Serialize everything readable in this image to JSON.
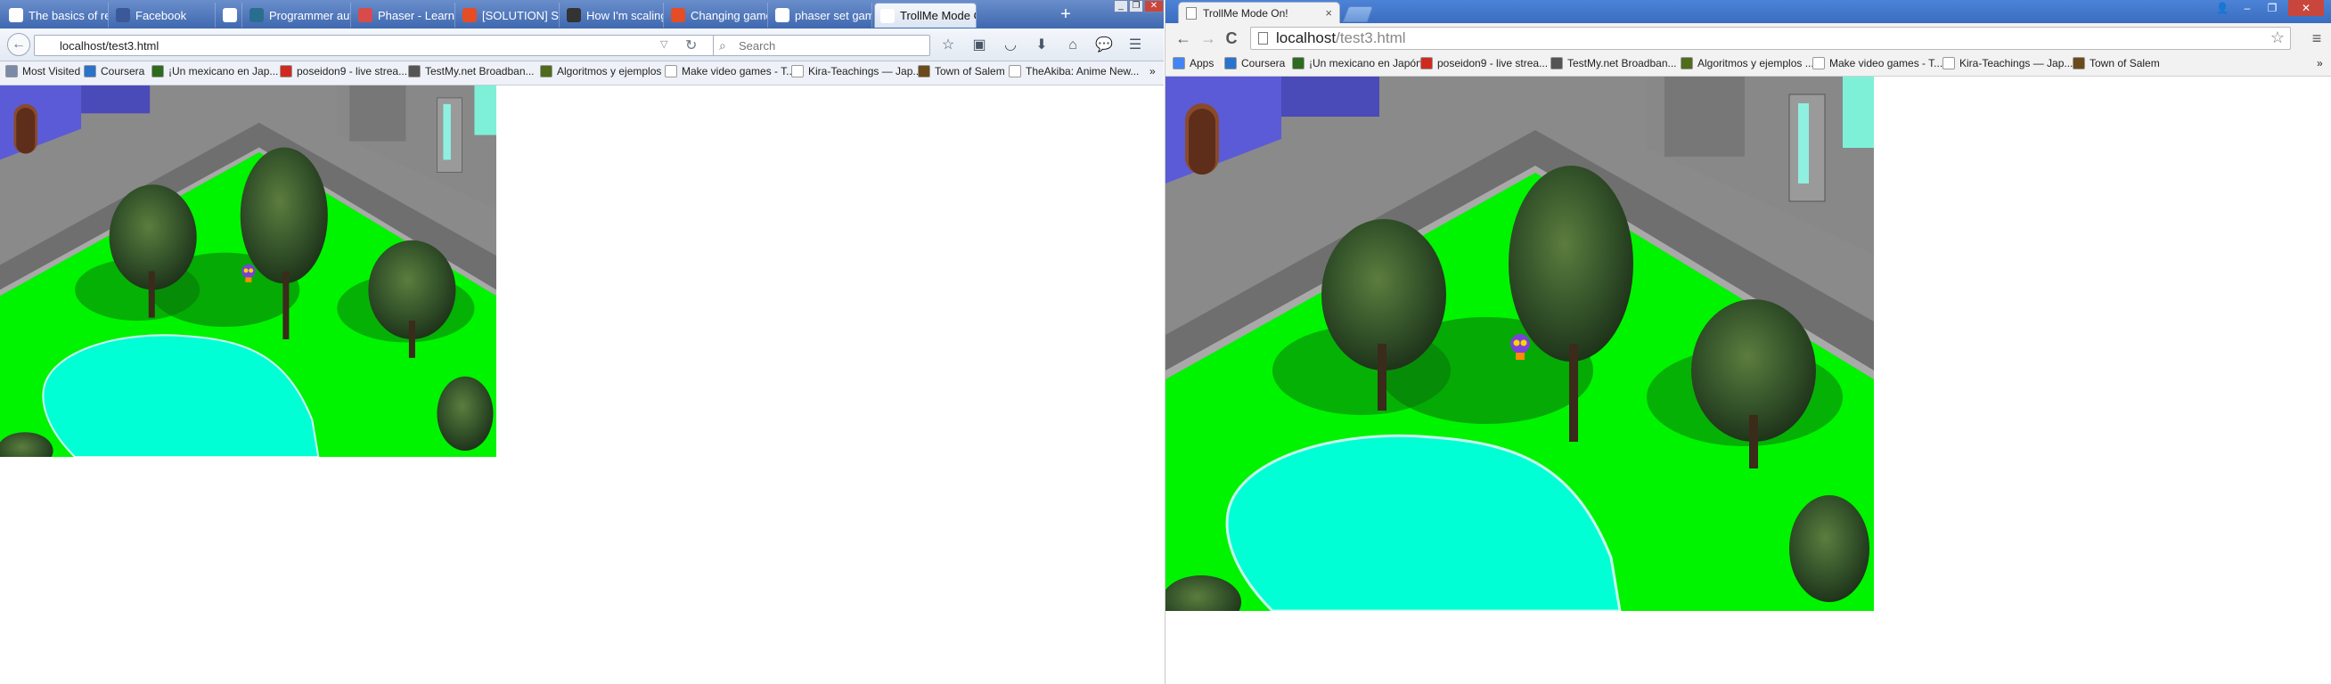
{
  "firefox": {
    "tabs": [
      {
        "label": "The basics of respon...",
        "icon": "page-icon",
        "color": "#ffffff"
      },
      {
        "label": "Facebook",
        "icon": "facebook-icon",
        "color": "#3b5998"
      },
      {
        "label": "",
        "icon": "speaker-icon",
        "color": "#ffffff"
      },
      {
        "label": "Programmer aut...",
        "icon": "bi-icon",
        "color": "#2a6e8f"
      },
      {
        "label": "Phaser - Learn - ...",
        "icon": "phaser-icon",
        "color": "#d84b4b"
      },
      {
        "label": "[SOLUTION] Sca...",
        "icon": "html5-icon",
        "color": "#e44d26"
      },
      {
        "label": "How I'm scaling ...",
        "icon": "github-icon",
        "color": "#333333"
      },
      {
        "label": "Changing game ...",
        "icon": "html5-icon",
        "color": "#e44d26"
      },
      {
        "label": "phaser set game...",
        "icon": "google-icon",
        "color": "#ffffff"
      },
      {
        "label": "TrollMe Mode On!",
        "icon": "page-icon",
        "color": "#ffffff",
        "active": true
      }
    ],
    "newtab": "+",
    "window_buttons": {
      "minimize": "_",
      "restore": "❐",
      "close": "✕"
    },
    "back": "←",
    "url": "localhost/test3.html",
    "url_dropdown": "▽",
    "reload": "↻",
    "search_placeholder": "Search",
    "search_icon": "search-icon",
    "toolbar": [
      {
        "name": "bookmark-star-icon",
        "glyph": "☆"
      },
      {
        "name": "reading-list-icon",
        "glyph": "▣"
      },
      {
        "name": "pocket-icon",
        "glyph": "◡"
      },
      {
        "name": "download-icon",
        "glyph": "⬇"
      },
      {
        "name": "home-icon",
        "glyph": "⌂"
      },
      {
        "name": "chat-icon",
        "glyph": "💬"
      },
      {
        "name": "menu-icon",
        "glyph": "☰"
      }
    ],
    "bookmarks": [
      {
        "label": "Most Visited",
        "color": "#7a8aa8"
      },
      {
        "label": "Coursera",
        "color": "#2a73cc"
      },
      {
        "label": "¡Un mexicano en Jap...",
        "color": "#2d6b1f"
      },
      {
        "label": "poseidon9 - live strea...",
        "color": "#d02a20"
      },
      {
        "label": "TestMy.net Broadban...",
        "color": "#555555"
      },
      {
        "label": "Algoritmos y ejemplos ...",
        "color": "#4f6b1c"
      },
      {
        "label": "Make video games - T...",
        "color": "#ffffff"
      },
      {
        "label": "Kira-Teachings — Jap...",
        "color": "#ffffff"
      },
      {
        "label": "Town of Salem",
        "color": "#6b4a1c"
      },
      {
        "label": "TheAkiba: Anime New...",
        "color": "#ffffff"
      }
    ],
    "overflow": "»"
  },
  "chrome": {
    "tab_title": "TrollMe Mode On!",
    "tab_close": "×",
    "window_buttons": {
      "user": "👤",
      "minimize": "–",
      "restore": "❐",
      "close": "✕"
    },
    "back": "←",
    "forward": "→",
    "reload": "C",
    "url_host": "localhost",
    "url_path": "/test3.html",
    "star": "☆",
    "menu": "≡",
    "bookmarks": [
      {
        "label": "Apps",
        "color": "#4285f4"
      },
      {
        "label": "Coursera",
        "color": "#2a73cc"
      },
      {
        "label": "¡Un mexicano en Japón!",
        "color": "#2d6b1f"
      },
      {
        "label": "poseidon9 - live strea...",
        "color": "#d02a20"
      },
      {
        "label": "TestMy.net Broadban...",
        "color": "#555555"
      },
      {
        "label": "Algoritmos y ejemplos ...",
        "color": "#4f6b1c"
      },
      {
        "label": "Make video games - T...",
        "color": "#ffffff"
      },
      {
        "label": "Kira-Teachings — Jap...",
        "color": "#ffffff"
      },
      {
        "label": "Town of Salem",
        "color": "#6b4a1c"
      }
    ],
    "overflow": "»"
  },
  "game": {
    "colors": {
      "grass": "#00f400",
      "road": "#6f6f6f",
      "road_edge": "#a9a9a9",
      "wall": "#5b5bd8",
      "pond": "#00ffd5",
      "building": "#777777",
      "tree": "#2c4a22"
    }
  }
}
